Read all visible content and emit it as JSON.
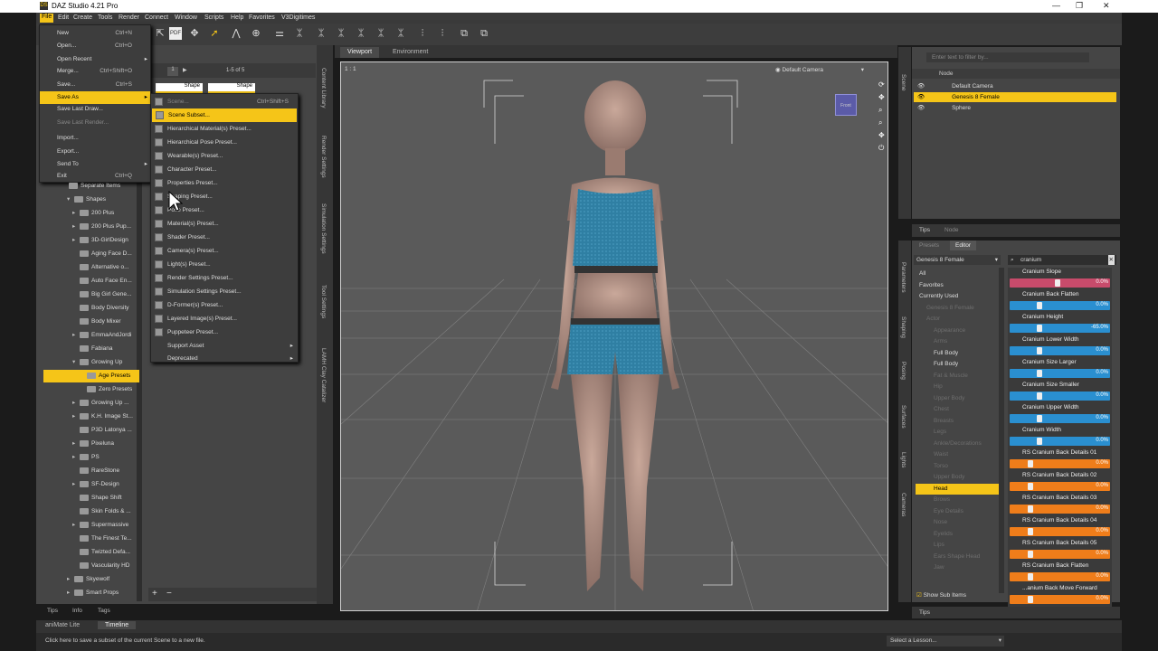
{
  "app": {
    "title": "DAZ Studio 4.21 Pro",
    "icon_text": "DS"
  },
  "window_controls": {
    "minimize": "—",
    "maximize": "❐",
    "close": "✕"
  },
  "menubar": [
    "File",
    "Edit",
    "Create",
    "Tools",
    "Render",
    "Connect",
    "Window",
    "Scripts",
    "Help",
    "Favorites",
    "V3Digitimes"
  ],
  "file_menu": [
    {
      "label": "New",
      "shortcut": "Ctrl+N"
    },
    {
      "label": "Open...",
      "shortcut": "Ctrl+O"
    },
    {
      "label": "Open Recent",
      "shortcut": "",
      "sub": "▸"
    },
    {
      "label": "Merge...",
      "shortcut": "Ctrl+Shift+O"
    },
    {
      "label": "Save...",
      "shortcut": "Ctrl+S"
    },
    {
      "label": "Save As",
      "shortcut": "",
      "sub": "▸"
    },
    {
      "label": "Save Last Draw...",
      "shortcut": ""
    },
    {
      "label": "Save Last Render...",
      "shortcut": ""
    },
    {
      "label": "Import...",
      "shortcut": ""
    },
    {
      "label": "Export...",
      "shortcut": ""
    },
    {
      "label": "Send To",
      "shortcut": "",
      "sub": "▸"
    },
    {
      "label": "Exit",
      "shortcut": "Ctrl+Q"
    }
  ],
  "saveas_menu": [
    {
      "label": "Scene...",
      "shortcut": "Ctrl+Shift+S"
    },
    {
      "label": "Scene Subset...",
      "shortcut": ""
    },
    {
      "label": "Hierarchical Material(s) Preset...",
      "shortcut": ""
    },
    {
      "label": "Hierarchical Pose Preset...",
      "shortcut": ""
    },
    {
      "label": "Wearable(s) Preset...",
      "shortcut": ""
    },
    {
      "label": "Character Preset...",
      "shortcut": ""
    },
    {
      "label": "Properties Preset...",
      "shortcut": ""
    },
    {
      "label": "Shaping Preset...",
      "shortcut": ""
    },
    {
      "label": "Pose Preset...",
      "shortcut": ""
    },
    {
      "label": "Material(s) Preset...",
      "shortcut": ""
    },
    {
      "label": "Shader Preset...",
      "shortcut": ""
    },
    {
      "label": "Camera(s) Preset...",
      "shortcut": ""
    },
    {
      "label": "Light(s) Preset...",
      "shortcut": ""
    },
    {
      "label": "Render Settings Preset...",
      "shortcut": ""
    },
    {
      "label": "Simulation Settings Preset...",
      "shortcut": ""
    },
    {
      "label": "D-Former(s) Preset...",
      "shortcut": ""
    },
    {
      "label": "Layered Image(s) Preset...",
      "shortcut": ""
    },
    {
      "label": "Puppeteer Preset...",
      "shortcut": ""
    },
    {
      "label": "Support Asset",
      "shortcut": "",
      "sub": "▸"
    },
    {
      "label": "Deprecated",
      "shortcut": "",
      "sub": "▸"
    }
  ],
  "content_library": {
    "pager": {
      "page": "1",
      "range": "1-5 of 5"
    },
    "thumbs": [
      "Shape",
      "Shape"
    ],
    "tree": [
      {
        "label": "Separate Items",
        "arrow": ""
      },
      {
        "label": "Shapes",
        "arrow": "▾"
      },
      {
        "label": "200 Plus",
        "arrow": "▸"
      },
      {
        "label": "200 Plus Pup...",
        "arrow": "▸"
      },
      {
        "label": "3D-GirlDesign",
        "arrow": "▸"
      },
      {
        "label": "Aging Face D...",
        "arrow": ""
      },
      {
        "label": "Alternative o...",
        "arrow": ""
      },
      {
        "label": "Auto Face En...",
        "arrow": ""
      },
      {
        "label": "Big Girl Gene...",
        "arrow": ""
      },
      {
        "label": "Body Diversity",
        "arrow": ""
      },
      {
        "label": "Body Mixer",
        "arrow": ""
      },
      {
        "label": "EmmaAndJordi",
        "arrow": "▸"
      },
      {
        "label": "Fabiana",
        "arrow": ""
      },
      {
        "label": "Growing Up",
        "arrow": "▾"
      },
      {
        "label": "Age Presets",
        "arrow": ""
      },
      {
        "label": "Zero Presets",
        "arrow": ""
      },
      {
        "label": "Growing Up ...",
        "arrow": "▸"
      },
      {
        "label": "K.H. Image St...",
        "arrow": "▸"
      },
      {
        "label": "P3D Latonya ...",
        "arrow": ""
      },
      {
        "label": "Pixeluna",
        "arrow": "▸"
      },
      {
        "label": "PS",
        "arrow": "▸"
      },
      {
        "label": "RareStone",
        "arrow": ""
      },
      {
        "label": "SF-Design",
        "arrow": "▸"
      },
      {
        "label": "Shape Shift",
        "arrow": ""
      },
      {
        "label": "Skin Folds & ...",
        "arrow": ""
      },
      {
        "label": "Supermassive",
        "arrow": "▸"
      },
      {
        "label": "The Finest Te...",
        "arrow": ""
      },
      {
        "label": "Twizted Defa...",
        "arrow": ""
      },
      {
        "label": "Vascularity HD",
        "arrow": ""
      },
      {
        "label": "Skyewolf",
        "arrow": "▸"
      },
      {
        "label": "Smart Props",
        "arrow": "▸"
      }
    ],
    "selected_index": 14,
    "bottom_tabs": [
      "Tips",
      "Info",
      "Tags"
    ]
  },
  "side_rails": [
    "Content Library",
    "Render Settings",
    "Simulation Settings",
    "Tool Settings",
    "LAMH Clay Catalizer"
  ],
  "viewport": {
    "tabs": [
      "Viewport",
      "Environment"
    ],
    "corner": "1 : 1",
    "camera": "Default Camera",
    "cube_label": "Front"
  },
  "scene": {
    "search_placeholder": "Enter text to filter by...",
    "header": "Node",
    "nodes": [
      "Default Camera",
      "Genesis 8 Female",
      "Sphere"
    ],
    "selected": 1,
    "tabs": [
      "Tips",
      "Node"
    ]
  },
  "parameters": {
    "tabs": [
      "Presets",
      "Editor"
    ],
    "figure": "Genesis 8 Female",
    "search": "cranium",
    "categories": [
      {
        "label": "All",
        "dim": false
      },
      {
        "label": "Favorites",
        "dim": false
      },
      {
        "label": "Currently Used",
        "dim": false
      },
      {
        "label": "Genesis 8 Female",
        "dim": true
      },
      {
        "label": "Actor",
        "dim": true
      },
      {
        "label": "Appearance",
        "dim": true
      },
      {
        "label": "Arms",
        "dim": true
      },
      {
        "label": "Full Body",
        "dim": false
      },
      {
        "label": "Full Body",
        "dim": false
      },
      {
        "label": "Fat & Muscle",
        "dim": true
      },
      {
        "label": "Hip",
        "dim": true
      },
      {
        "label": "Upper Body",
        "dim": true
      },
      {
        "label": "Chest",
        "dim": true
      },
      {
        "label": "Breasts",
        "dim": true
      },
      {
        "label": "Legs",
        "dim": true
      },
      {
        "label": "Ankle/Decorations",
        "dim": true
      },
      {
        "label": "Waist",
        "dim": true
      },
      {
        "label": "Torso",
        "dim": true
      },
      {
        "label": "Upper Body",
        "dim": true
      },
      {
        "label": "Head",
        "dim": false
      },
      {
        "label": "Brows",
        "dim": true
      },
      {
        "label": "Eye Details",
        "dim": true
      },
      {
        "label": "Nose",
        "dim": true
      },
      {
        "label": "Eyelids",
        "dim": true
      },
      {
        "label": "Lips",
        "dim": true
      },
      {
        "label": "Ears Shape Head",
        "dim": true
      },
      {
        "label": "Jaw",
        "dim": true
      }
    ],
    "cat_selected": 19,
    "sliders": [
      {
        "name": "Cranium Slope",
        "value": "0.0%",
        "color": "#c84b6b",
        "knob": 0.5
      },
      {
        "name": "Cranium Back Flatten",
        "value": "0.0%",
        "color": "#2a8fd0",
        "knob": 0.3
      },
      {
        "name": "Cranium Height",
        "value": "-65.0%",
        "color": "#2a8fd0",
        "knob": 0.3
      },
      {
        "name": "Cranium Lower Width",
        "value": "0.0%",
        "color": "#2a8fd0",
        "knob": 0.3
      },
      {
        "name": "Cranium Size Larger",
        "value": "0.0%",
        "color": "#2a8fd0",
        "knob": 0.3
      },
      {
        "name": "Cranium Size Smaller",
        "value": "0.0%",
        "color": "#2a8fd0",
        "knob": 0.3
      },
      {
        "name": "Cranium Upper Width",
        "value": "0.0%",
        "color": "#2a8fd0",
        "knob": 0.3
      },
      {
        "name": "Cranium Width",
        "value": "0.0%",
        "color": "#2a8fd0",
        "knob": 0.3
      },
      {
        "name": "RS Cranium Back Details 01",
        "value": "0.0%",
        "color": "#ef7d1a",
        "knob": 0.2
      },
      {
        "name": "RS Cranium Back Details 02",
        "value": "0.0%",
        "color": "#ef7d1a",
        "knob": 0.2
      },
      {
        "name": "RS Cranium Back Details 03",
        "value": "0.0%",
        "color": "#ef7d1a",
        "knob": 0.2
      },
      {
        "name": "RS Cranium Back Details 04",
        "value": "0.0%",
        "color": "#ef7d1a",
        "knob": 0.2
      },
      {
        "name": "RS Cranium Back Details 05",
        "value": "0.0%",
        "color": "#ef7d1a",
        "knob": 0.2
      },
      {
        "name": "RS Cranium Back Flatten",
        "value": "0.0%",
        "color": "#ef7d1a",
        "knob": 0.2
      },
      {
        "name": "...anium Back Move Forward",
        "value": "0.0%",
        "color": "#ef7d1a",
        "knob": 0.2
      }
    ],
    "show_sub": "Show Sub Items",
    "side_tabs": [
      "Parameters",
      "Shaping",
      "Posing",
      "Surfaces",
      "Lights",
      "Cameras"
    ]
  },
  "bottom": {
    "tabs": [
      "aniMate Lite",
      "Timeline"
    ],
    "status": "Click here to save a subset of the current Scene to a new file.",
    "lesson": "Select a Lesson...",
    "right_tab": "Tips"
  }
}
